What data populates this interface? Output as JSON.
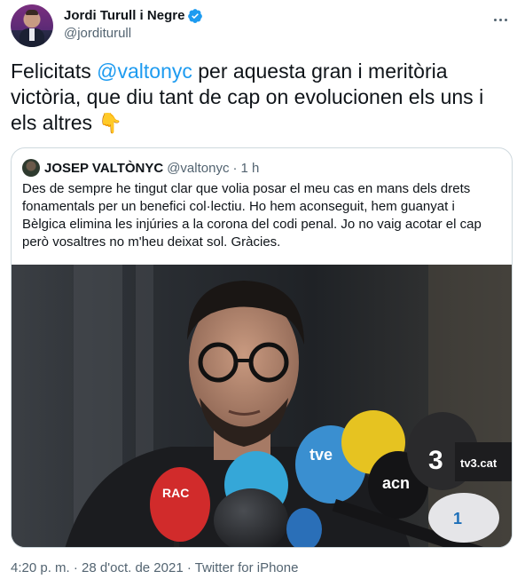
{
  "author": {
    "display_name": "Jordi Turull i Negre",
    "handle": "@jorditurull"
  },
  "tweet": {
    "text_before": "Felicitats ",
    "mention": "@valtonyc",
    "text_after": " per aquesta gran i meritòria victòria, que diu tant de cap on evolucionen els uns i els altres ",
    "emoji": "👇"
  },
  "quoted_tweet": {
    "display_name": "JOSEP VALTÒNYC",
    "handle": "@valtonyc",
    "separator": "·",
    "time": "1 h",
    "text": "Des de sempre he tingut clar que volia posar el meu cas en mans dels drets fonamentals per un benefici col·lectiu. Ho hem aconseguit, hem guanyat i Bèlgica elimina les injúries a la corona del codi penal. Jo no vaig acotar el cap però vosaltres no m'heu deixat sol. Gràcies.",
    "media": {
      "mic_labels": {
        "rac": "RAC",
        "tve": "tve",
        "acn": "acn",
        "tv3": "3",
        "tv3cat": "tv3.cat",
        "catradio": "1"
      }
    }
  },
  "footer": {
    "time": "4:20 p. m.",
    "sep1": " · ",
    "date": "28 d'oct. de 2021",
    "sep2": " · ",
    "source": "Twitter for iPhone"
  },
  "colors": {
    "accent": "#1d9bf0",
    "secondary_text": "#536471",
    "border": "#cfd9de"
  },
  "icons": [
    "verified-badge-icon",
    "more-options-icon"
  ]
}
